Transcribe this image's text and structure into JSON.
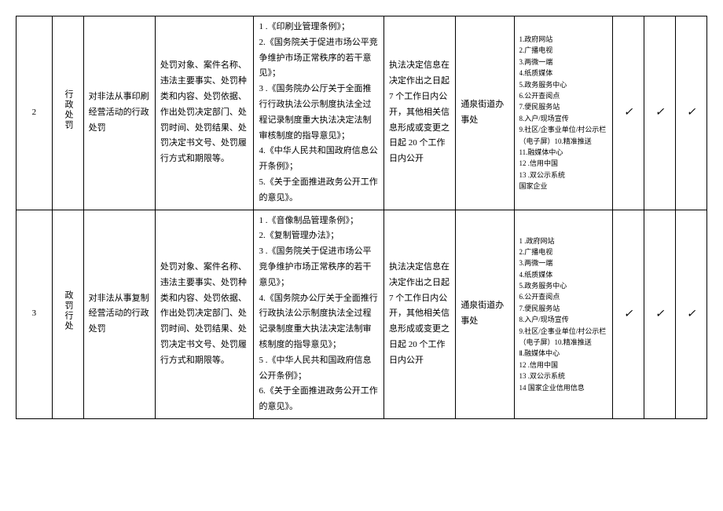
{
  "rows": [
    {
      "num": "2",
      "cat": "行政处罚",
      "name": "对非法从事印刷经营活动的行政处罚",
      "content": "处罚对象、案件名称、违法主要事实、处罚种类和内容、处罚依据、作出处罚决定部门、处罚时间、处罚结果、处罚决定书文号、处罚履行方式和期限等。",
      "basis": "1 .《印刷业管理条例》；\n2.《国务院关于促进市场公平竞争维护市场正常秩序的若干意见》；\n3 .《国务院办公厅关于全面推行行政执法公示制度执法全过程记录制度重大执法决定法制审核制度的指导意见》；\n4.《中华人民共和国政府信息公开条例》；\n5.《关于全面推进政务公开工作的意见》。",
      "time": "执法决定信息在决定作出之日起 7 个工作日内公开，其他相关信息形成或变更之日起 20 个工作日内公开",
      "subject": "通泉街道办事处",
      "channels": [
        "1.政府网站",
        "2.广播电视",
        "3.两微一端",
        "4.纸质媒体",
        "5.政务服务中心",
        "6.公开查阅点",
        "7.便民服务站",
        "8.入户/现场宣传",
        "9.社区/企事业单位/村公示栏（电子屏）10.精准推送",
        "11.融媒体中心",
        "12 .信用中国",
        "13 .双公示系统",
        " 国家企业"
      ],
      "check1": "✓",
      "check2": "✓",
      "check3": "✓"
    },
    {
      "num": "3",
      "cat": "政罚行处",
      "name": "对非法从事复制经营活动的行政处罚",
      "content": "处罚对象、案件名称、违法主要事实、处罚种类和内容、处罚依据、作出处罚决定部门、处罚时间、处罚结果、处罚决定书文号、处罚履行方式和期限等。",
      "basis": "1 .《音像制品管理条例》；\n2.《复制管理办法》；\n3 .《国务院关于促进市场公平竞争维护市场正常秩序的若干意见》；\n4.《国务院办公厅关于全面推行行政执法公示制度执法全过程记录制度重大执法决定法制审核制度的指导意见》；\n5 .《中华人民共和国政府信息公开条例》；\n6.《关于全面推进政务公开工作的意见》。",
      "time": "执法决定信息在决定作出之日起 7 个工作日内公开，其他相关信息形成或变更之日起 20 个工作日内公开",
      "subject": "通泉街道办事处",
      "channels": [
        "1 .政府网站",
        "2.广播电视",
        "3.两微一端",
        "4.纸质媒体",
        "5.政务服务中心",
        "6.公开查阅点",
        "7.便民服务站",
        "8.入户/现场宣传",
        "9.社区/企事业单位/村公示栏（电子屏）10.精准推送",
        "Ⅱ.融媒体中心",
        "12 .信用中国",
        "13 .双公示系统",
        "14 国家企业信用信息"
      ],
      "check1": "✓",
      "check2": "✓",
      "check3": "✓"
    }
  ]
}
